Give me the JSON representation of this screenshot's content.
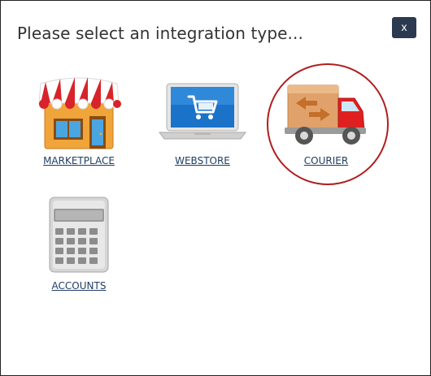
{
  "dialog": {
    "title": "Please select an integration type...",
    "close_label": "x"
  },
  "tiles": [
    {
      "label": "MARKETPLACE",
      "icon": "storefront-icon"
    },
    {
      "label": "WEBSTORE",
      "icon": "laptop-cart-icon"
    },
    {
      "label": "COURIER",
      "icon": "delivery-truck-icon",
      "highlighted": true
    },
    {
      "label": "ACCOUNTS",
      "icon": "calculator-icon"
    }
  ],
  "colors": {
    "link": "#1f3e63",
    "close_button": "#2b3a50",
    "highlight_ring": "#b01e1e"
  }
}
